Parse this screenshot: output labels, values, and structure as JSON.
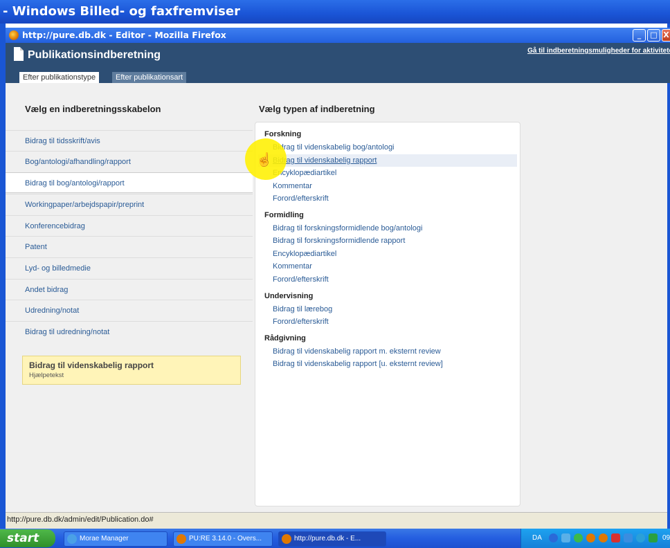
{
  "outer_window": {
    "title": "- Windows Billed- og faxfremviser"
  },
  "browser": {
    "title": "http://pure.db.dk - Editor - Mozilla Firefox",
    "minimize": "_",
    "maximize": "□",
    "close": "X"
  },
  "header": {
    "title": "Publikationsindberetning",
    "top_link": "Gå til indberetningsmuligheder for aktiviteter",
    "tabs": [
      {
        "label": "Efter publikationstype",
        "active": true
      },
      {
        "label": "Efter publikationsart",
        "active": false
      }
    ]
  },
  "left_panel": {
    "heading": "Vælg en indberetningsskabelon",
    "items": [
      {
        "label": "Bidrag til tidsskrift/avis"
      },
      {
        "label": "Bog/antologi/afhandling/rapport"
      },
      {
        "label": "Bidrag til bog/antologi/rapport",
        "selected": true
      },
      {
        "label": "Workingpaper/arbejdspapir/preprint"
      },
      {
        "label": "Konferencebidrag"
      },
      {
        "label": "Patent"
      },
      {
        "label": "Lyd- og billedmedie"
      },
      {
        "label": "Andet bidrag"
      },
      {
        "label": "Udredning/notat"
      },
      {
        "label": "Bidrag til udredning/notat"
      }
    ],
    "help": {
      "title": "Bidrag til videnskabelig rapport",
      "text": "Hjælpetekst"
    }
  },
  "right_panel": {
    "heading": "Vælg typen af indberetning",
    "categories": [
      {
        "title": "Forskning",
        "items": [
          "Bidrag til videnskabelig bog/antologi",
          "Bidrag til videnskabelig rapport",
          "Encyklopædiartikel",
          "Kommentar",
          "Forord/efterskrift"
        ]
      },
      {
        "title": "Formidling",
        "items": [
          "Bidrag til forskningsformidlende bog/antologi",
          "Bidrag til forskningsformidlende rapport",
          "Encyklopædiartikel",
          "Kommentar",
          "Forord/efterskrift"
        ]
      },
      {
        "title": "Undervisning",
        "items": [
          "Bidrag til lærebog",
          "Forord/efterskrift"
        ]
      },
      {
        "title": "Rådgivning",
        "items": [
          "Bidrag til videnskabelig rapport m. eksternt review",
          "Bidrag til videnskabelig rapport [u. eksternt review]"
        ]
      }
    ],
    "hovered_item": "Bidrag til videnskabelig rapport"
  },
  "status_bar": {
    "text": "http://pure.db.dk/admin/edit/Publication.do#"
  },
  "taskbar": {
    "start": "start",
    "tasks": [
      {
        "label": "Morae Manager",
        "icon": "morae-icon",
        "color": "#4aa0e6"
      },
      {
        "label": "PU:RE 3.14.0 - Overs...",
        "icon": "firefox-icon",
        "color": "#e07800"
      },
      {
        "label": "http://pure.db.dk - E...",
        "icon": "firefox-icon",
        "color": "#e07800",
        "active": true
      }
    ],
    "tray": {
      "lang": "DA",
      "clock": "09"
    }
  },
  "colors": {
    "header": "#2d4e74",
    "link": "#2a5b96",
    "help_bg": "#fff4b8",
    "xp_blue": "#245ee0",
    "start_green": "#3a9d35"
  }
}
